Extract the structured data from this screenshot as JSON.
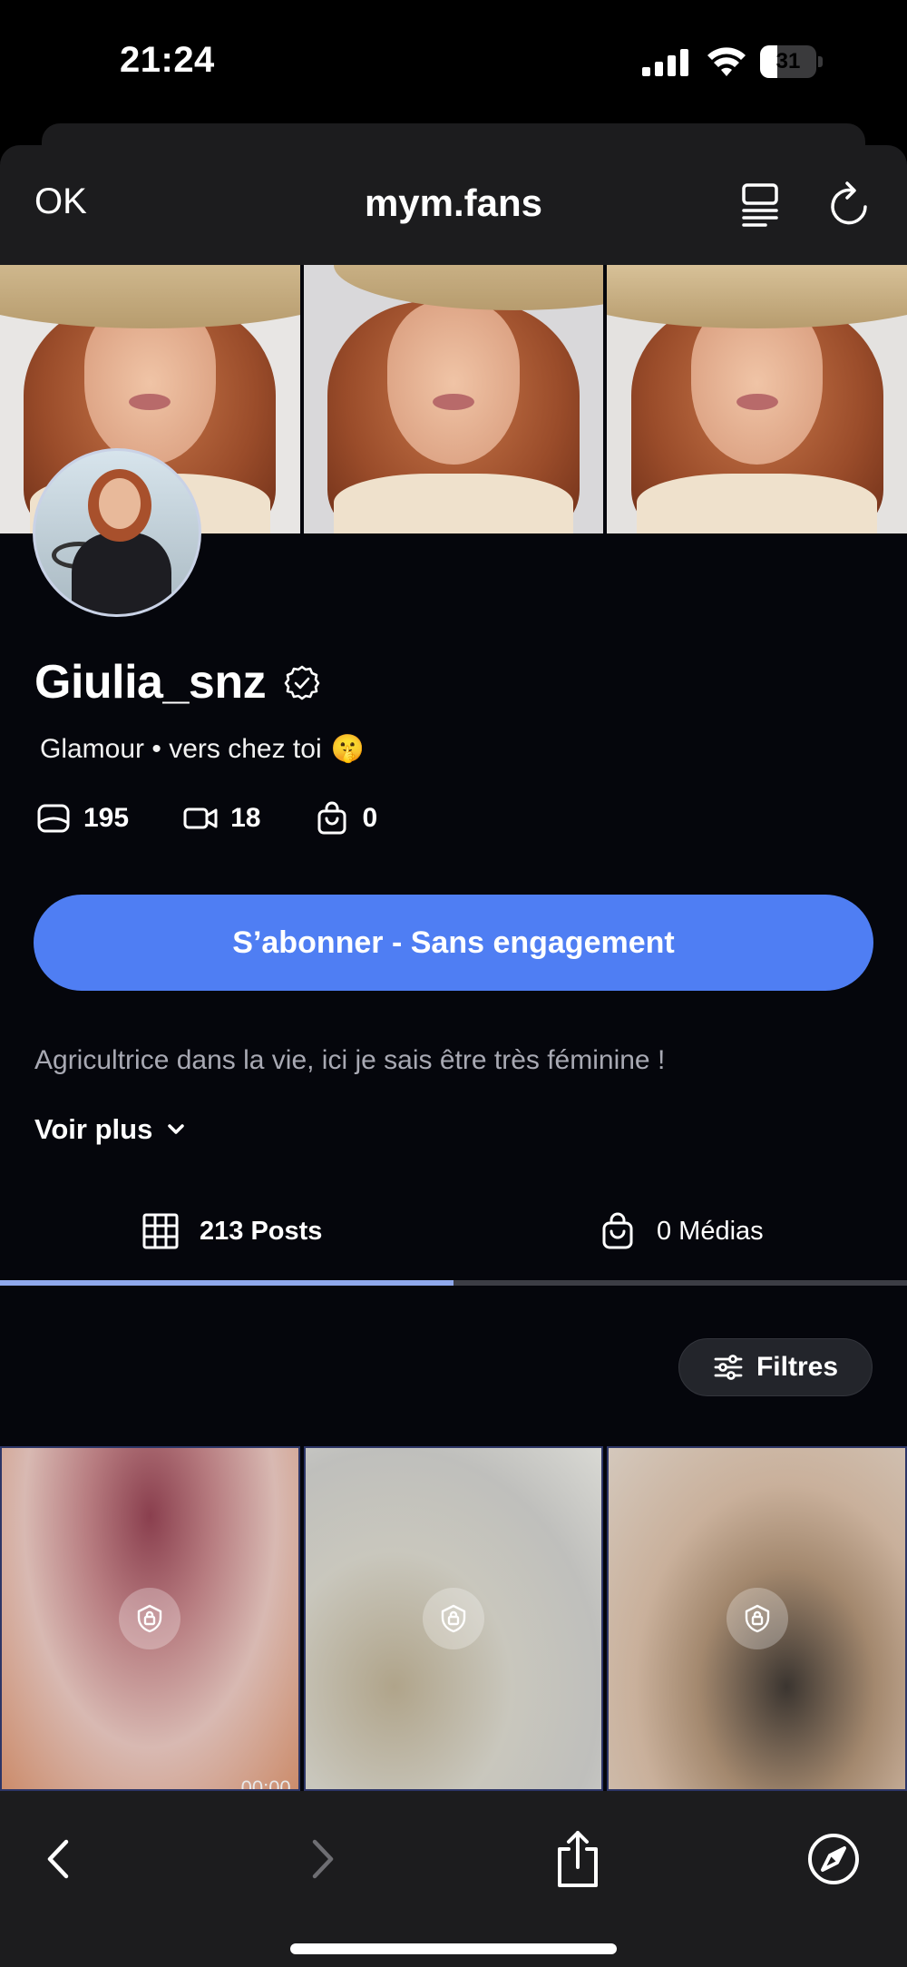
{
  "status_bar": {
    "time": "21:24",
    "battery_level": "31",
    "icons": [
      "signal-icon",
      "wifi-icon",
      "battery-icon"
    ]
  },
  "browser": {
    "done_label": "OK",
    "domain": "mym.fans",
    "icons": [
      "reader-mode-icon",
      "reload-icon"
    ]
  },
  "profile": {
    "username": "Giulia_snz",
    "verified": true,
    "tagline": "Glamour • vers chez toi",
    "tagline_emoji": "🤫",
    "stats": {
      "posts_count": "195",
      "videos_count": "18",
      "products_count": "0"
    },
    "subscribe_label": "S’abonner - Sans engagement",
    "bio": "Agricultrice dans la vie, ici je sais être très féminine !",
    "voir_plus_label": "Voir plus"
  },
  "tabs": [
    {
      "label": "213 Posts",
      "icon": "grid-icon",
      "active": true
    },
    {
      "label": "0 Médias",
      "icon": "shopping-bag-icon",
      "active": false
    }
  ],
  "filters_label": "Filtres",
  "posts": [
    {
      "locked": true,
      "icon": "lock-icon",
      "duration": "00:00"
    },
    {
      "locked": true,
      "icon": "lock-icon"
    },
    {
      "locked": true,
      "icon": "lock-icon"
    }
  ],
  "toolbar": {
    "icons": [
      "back-icon",
      "forward-icon",
      "share-icon",
      "compass-icon"
    ]
  },
  "colors": {
    "accent": "#4f7ef3",
    "tab_indicator": "#8fa8ec",
    "page_background": "#05060c",
    "bar_background": "#1c1c1e"
  }
}
